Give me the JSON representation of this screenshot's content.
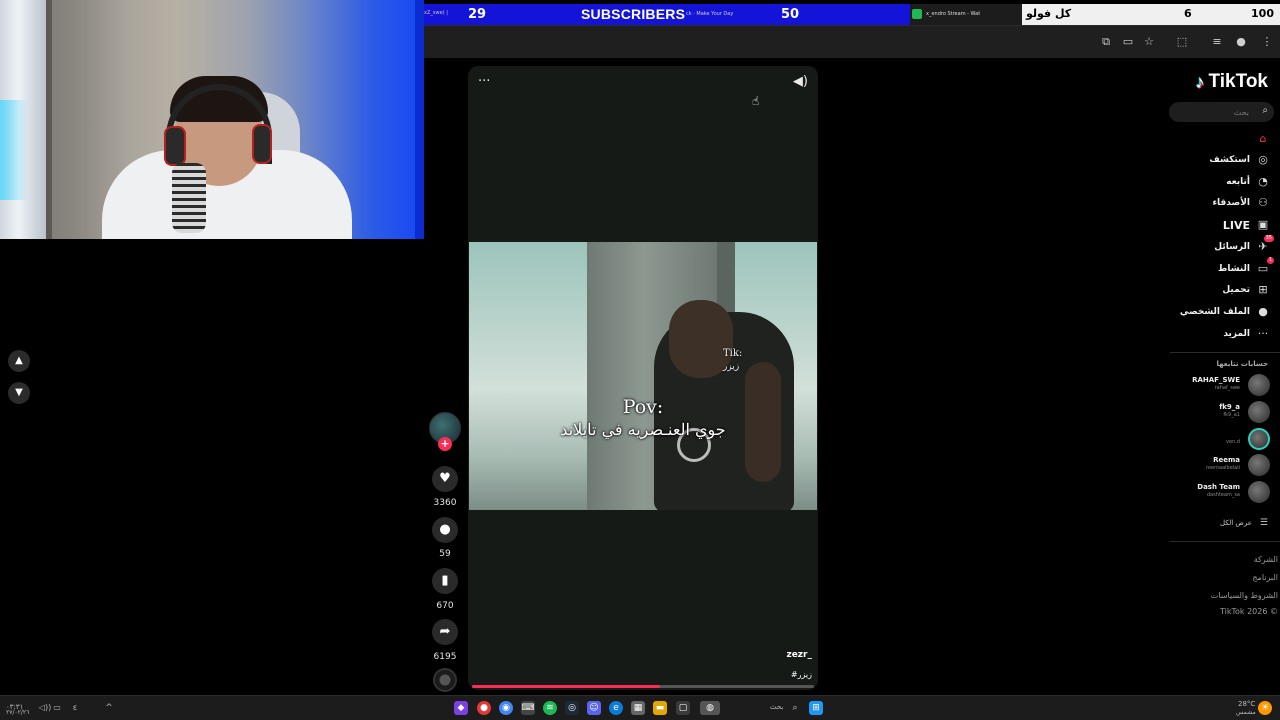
{
  "overlay": {
    "tiny_left": "xZ_swe) |",
    "subscriber_count": "29",
    "subscribers_label": "SUBSCRIBERS",
    "tiny_track": "ck · Make Your Day",
    "goal_count": "50",
    "tiny_stream": "x_endro Stream - Wat",
    "follower_label": "كل فولو",
    "follower_count": "6",
    "follower_goal": "100"
  },
  "sidebar": {
    "logo_text": "TikTok",
    "search_placeholder": "بحث",
    "nav": [
      {
        "label": "",
        "icon": "home-icon",
        "active": true
      },
      {
        "label": "استكشف",
        "icon": "explore-icon"
      },
      {
        "label": "أتابعه",
        "icon": "following-icon"
      },
      {
        "label": "الأصدقاء",
        "icon": "friends-icon"
      },
      {
        "label": "LIVE",
        "icon": "live-icon"
      },
      {
        "label": "الرسائل",
        "icon": "messages-icon",
        "badge": "35"
      },
      {
        "label": "النشاط",
        "icon": "activity-icon",
        "badge": "1"
      },
      {
        "label": "تحميل",
        "icon": "upload-icon"
      },
      {
        "label": "الملف الشخصي",
        "icon": "profile-icon"
      },
      {
        "label": "المزيد",
        "icon": "more-icon"
      }
    ],
    "following_title": "حسابات تتابعها",
    "following": [
      {
        "name": "RAHAF_SWE",
        "handle": "rahaf_swe"
      },
      {
        "name": "fk9_a",
        "handle": "fk9_a1"
      },
      {
        "name": "",
        "handle": "ven.d"
      },
      {
        "name": "Reema",
        "handle": "reemaalbelali"
      },
      {
        "name": "Dash Team",
        "handle": "dashteam_sa"
      }
    ],
    "see_all": "عرض الكل",
    "footer": [
      "الشركة",
      "البرنامج",
      "الشروط والسياسات",
      "TikTok 2026 ©"
    ]
  },
  "video": {
    "watermark_line1": "Tik:",
    "watermark_line2": "زيزر",
    "caption_line1": "Pov:",
    "caption_line2": "جوي العنـصريه في تايلاند",
    "author": "zezr_",
    "tag": "#زيزر",
    "progress": 0.55
  },
  "actions": {
    "likes": "3360",
    "comments": "59",
    "saves": "670",
    "shares": "6195"
  },
  "taskbar": {
    "search_label": "بحث",
    "weather": "28°C",
    "weather_sub": "مشمس",
    "clock_left": "٠٣:٣١",
    "date_left": "٢٧/٠٢/٢٦"
  }
}
